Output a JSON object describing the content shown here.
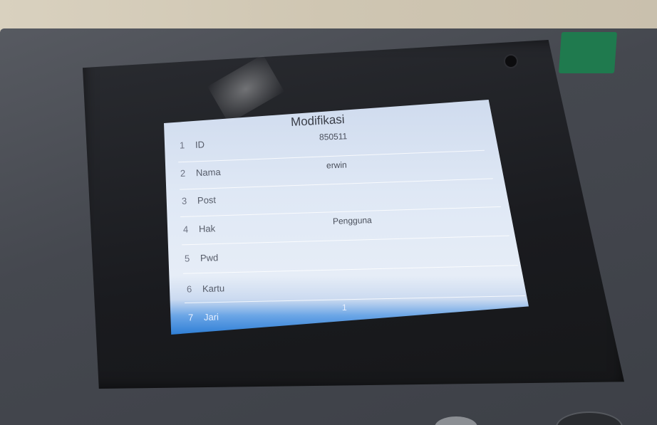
{
  "screen": {
    "title": "Modifikasi",
    "rows": [
      {
        "num": "1",
        "label": "ID",
        "value": "850511"
      },
      {
        "num": "2",
        "label": "Nama",
        "value": "erwin"
      },
      {
        "num": "3",
        "label": "Post",
        "value": ""
      },
      {
        "num": "4",
        "label": "Hak",
        "value": "Pengguna"
      },
      {
        "num": "5",
        "label": "Pwd",
        "value": ""
      },
      {
        "num": "6",
        "label": "Kartu",
        "value": ""
      },
      {
        "num": "7",
        "label": "Jari",
        "value": "1"
      }
    ],
    "selected_row": 7
  },
  "colors": {
    "screen_bg": "#dfe8f5",
    "selection": "#2f7fd6",
    "bezel": "#1a1b1f",
    "device_body": "#45484f",
    "green_tab": "#1f7a4e"
  }
}
